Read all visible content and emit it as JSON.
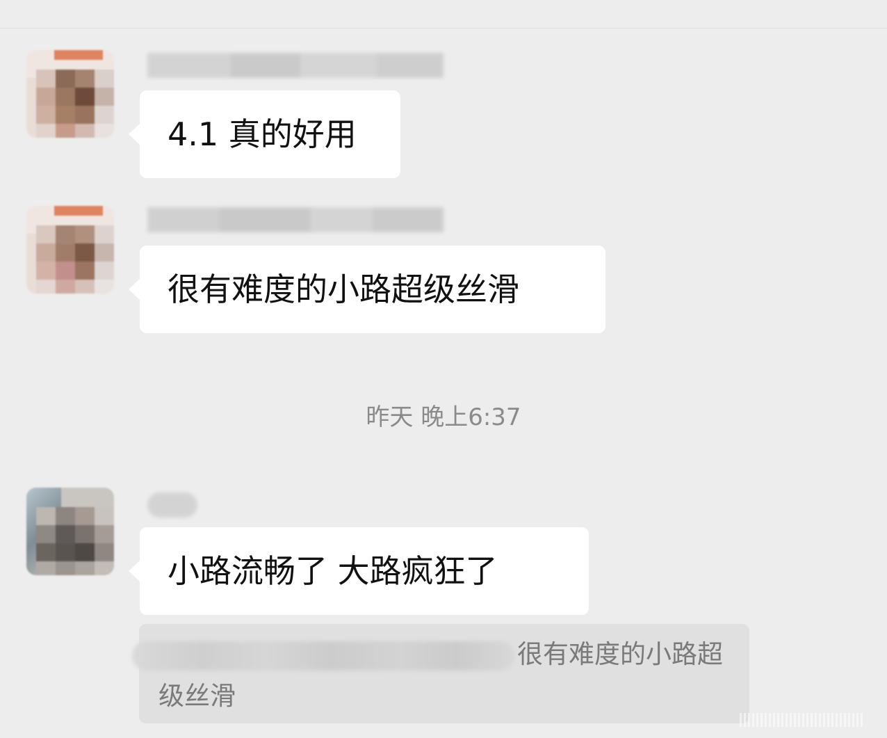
{
  "messages": [
    {
      "sender_name": "",
      "text": "4.1 真的好用"
    },
    {
      "sender_name": "",
      "text": "很有难度的小路超级丝滑"
    },
    {
      "sender_name": "",
      "text": "小路流畅了  大路疯狂了"
    }
  ],
  "timestamp": "昨天 晚上6:37",
  "quote": {
    "sender_prefix": "",
    "text": "很有难度的小路超级丝滑"
  },
  "colors": {
    "background": "#ededed",
    "bubble": "#ffffff",
    "quote_background": "#e0e0e0",
    "timestamp_text": "#8a8a8a"
  }
}
